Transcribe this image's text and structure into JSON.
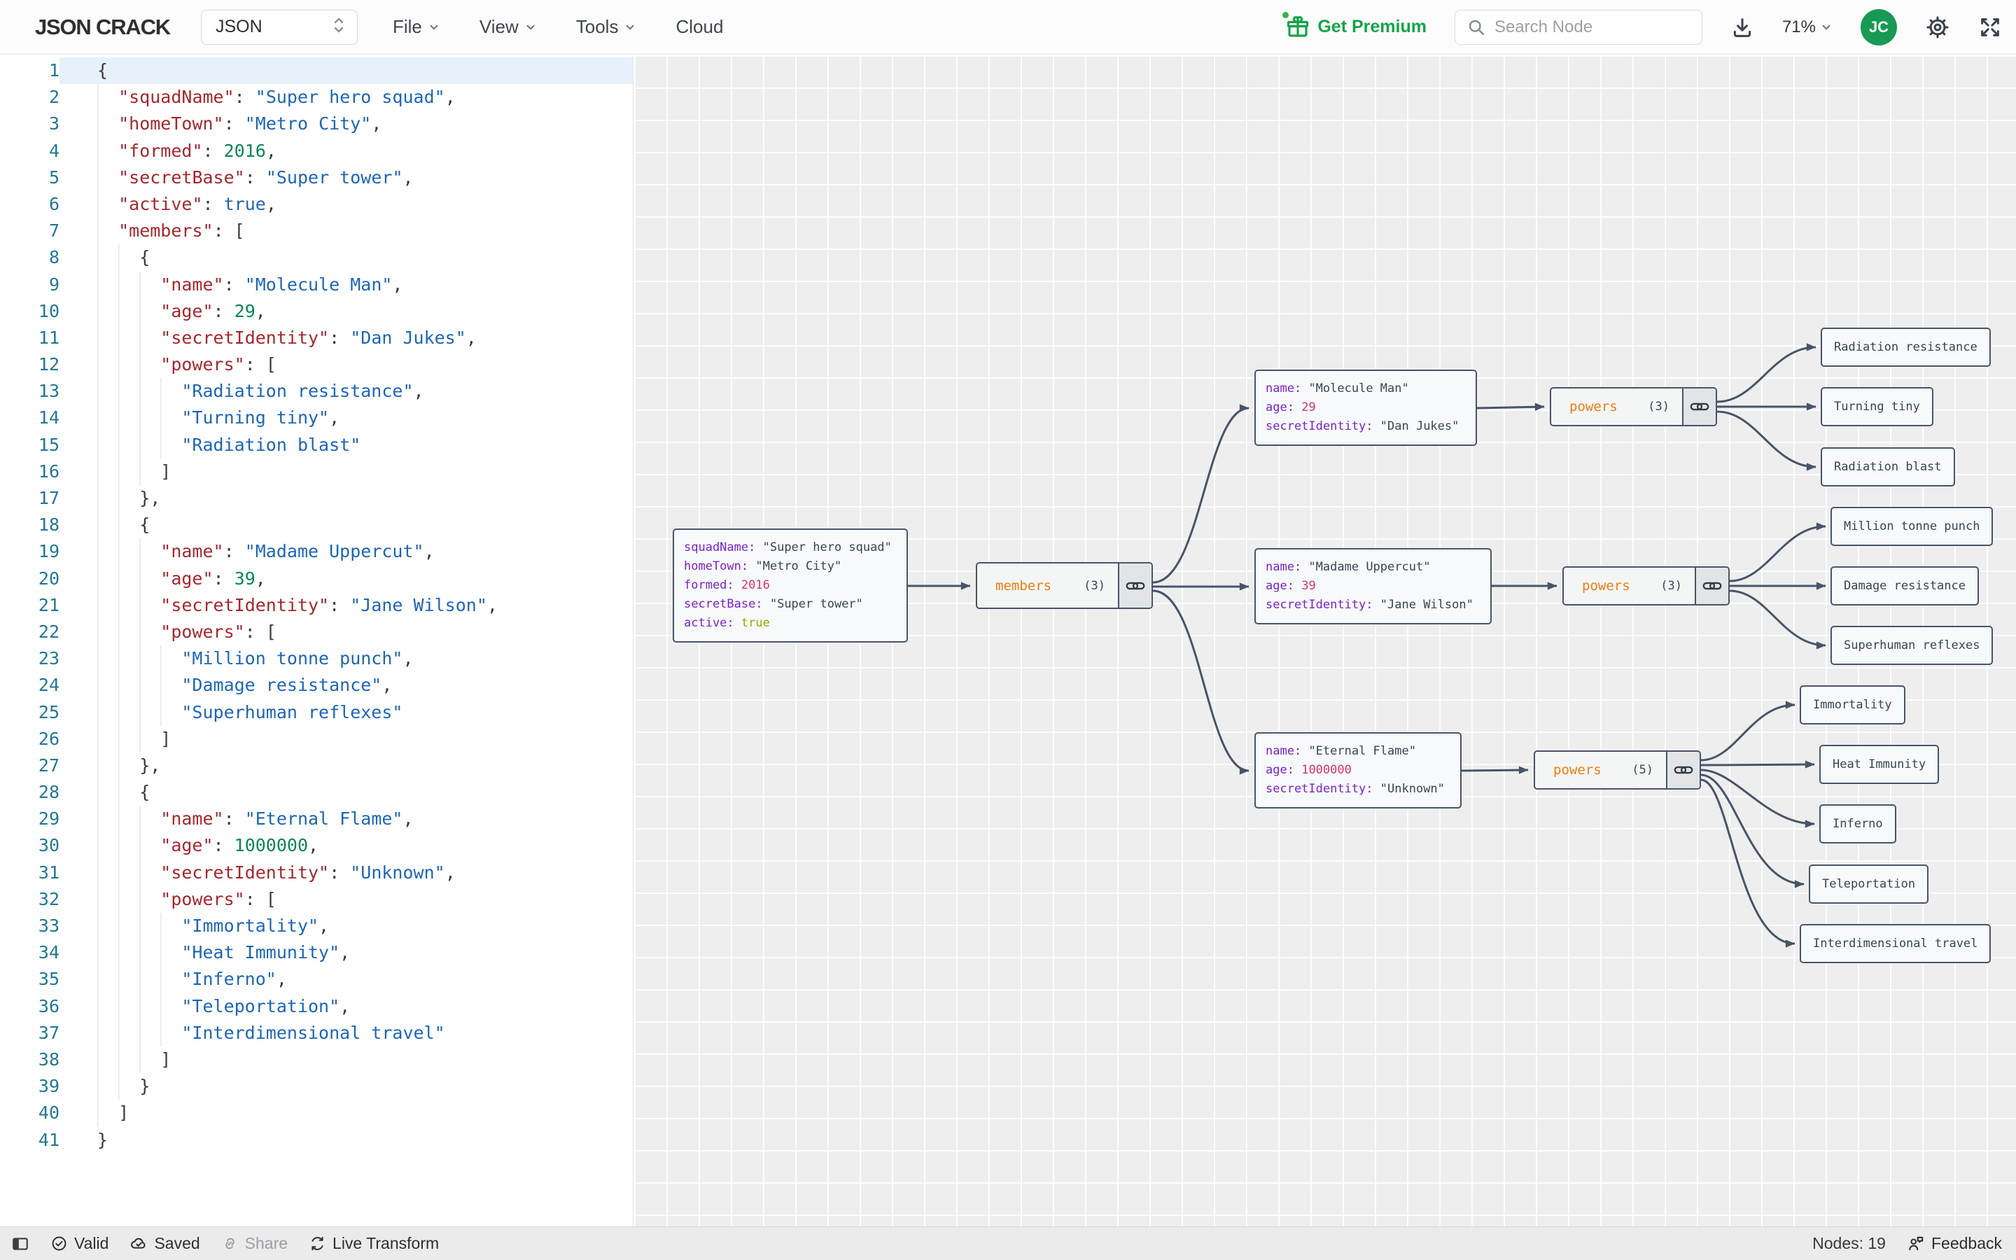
{
  "toolbar": {
    "logo": "JSON CRACK",
    "format_select": "JSON",
    "menus": [
      "File",
      "View",
      "Tools",
      "Cloud"
    ],
    "premium_label": "Get Premium",
    "search_placeholder": "Search Node",
    "zoom_level": "71%",
    "avatar_initials": "JC"
  },
  "colors": {
    "premium_green": "#16a34a",
    "avatar_green": "#189a54",
    "node_border": "#475569",
    "edge": "#475569",
    "key_purple": "#7d22c9",
    "number_pink": "#d6336c",
    "boolean_olive": "#9daa00",
    "array_label_orange": "#ef7d10",
    "editor_key_red": "#a5282d",
    "editor_string_blue": "#1e66b5",
    "editor_number_green": "#098658"
  },
  "editor": {
    "lines": [
      "{",
      "  \"squadName\": \"Super hero squad\",",
      "  \"homeTown\": \"Metro City\",",
      "  \"formed\": 2016,",
      "  \"secretBase\": \"Super tower\",",
      "  \"active\": true,",
      "  \"members\": [",
      "    {",
      "      \"name\": \"Molecule Man\",",
      "      \"age\": 29,",
      "      \"secretIdentity\": \"Dan Jukes\",",
      "      \"powers\": [",
      "        \"Radiation resistance\",",
      "        \"Turning tiny\",",
      "        \"Radiation blast\"",
      "      ]",
      "    },",
      "    {",
      "      \"name\": \"Madame Uppercut\",",
      "      \"age\": 39,",
      "      \"secretIdentity\": \"Jane Wilson\",",
      "      \"powers\": [",
      "        \"Million tonne punch\",",
      "        \"Damage resistance\",",
      "        \"Superhuman reflexes\"",
      "      ]",
      "    },",
      "    {",
      "      \"name\": \"Eternal Flame\",",
      "      \"age\": 1000000,",
      "      \"secretIdentity\": \"Unknown\",",
      "      \"powers\": [",
      "        \"Immortality\",",
      "        \"Heat Immunity\",",
      "        \"Inferno\",",
      "        \"Teleportation\",",
      "        \"Interdimensional travel\"",
      "      ]",
      "    }",
      "  ]",
      "}"
    ]
  },
  "graph": {
    "nodes": {
      "root": {
        "rows": [
          {
            "k": "squadName",
            "v": "\"Super hero squad\"",
            "t": "str"
          },
          {
            "k": "homeTown",
            "v": "\"Metro City\"",
            "t": "str"
          },
          {
            "k": "formed",
            "v": "2016",
            "t": "num"
          },
          {
            "k": "secretBase",
            "v": "\"Super tower\"",
            "t": "str"
          },
          {
            "k": "active",
            "v": "true",
            "t": "bool"
          }
        ]
      },
      "members": {
        "label": "members",
        "count": "(3)"
      },
      "member1": {
        "rows": [
          {
            "k": "name",
            "v": "\"Molecule Man\"",
            "t": "str"
          },
          {
            "k": "age",
            "v": "29",
            "t": "num"
          },
          {
            "k": "secretIdentity",
            "v": "\"Dan Jukes\"",
            "t": "str"
          }
        ]
      },
      "powers1": {
        "label": "powers",
        "count": "(3)"
      },
      "powers1_leaves": [
        "Radiation resistance",
        "Turning tiny",
        "Radiation blast"
      ],
      "member2": {
        "rows": [
          {
            "k": "name",
            "v": "\"Madame Uppercut\"",
            "t": "str"
          },
          {
            "k": "age",
            "v": "39",
            "t": "num"
          },
          {
            "k": "secretIdentity",
            "v": "\"Jane Wilson\"",
            "t": "str"
          }
        ]
      },
      "powers2": {
        "label": "powers",
        "count": "(3)"
      },
      "powers2_leaves": [
        "Million tonne punch",
        "Damage resistance",
        "Superhuman reflexes"
      ],
      "member3": {
        "rows": [
          {
            "k": "name",
            "v": "\"Eternal Flame\"",
            "t": "str"
          },
          {
            "k": "age",
            "v": "1000000",
            "t": "num"
          },
          {
            "k": "secretIdentity",
            "v": "\"Unknown\"",
            "t": "str"
          }
        ]
      },
      "powers3": {
        "label": "powers",
        "count": "(5)"
      },
      "powers3_leaves": [
        "Immortality",
        "Heat Immunity",
        "Inferno",
        "Teleportation",
        "Interdimensional travel"
      ]
    }
  },
  "statusbar": {
    "valid": "Valid",
    "saved": "Saved",
    "share": "Share",
    "live_transform": "Live Transform",
    "nodes_count": "Nodes: 19",
    "feedback": "Feedback"
  }
}
